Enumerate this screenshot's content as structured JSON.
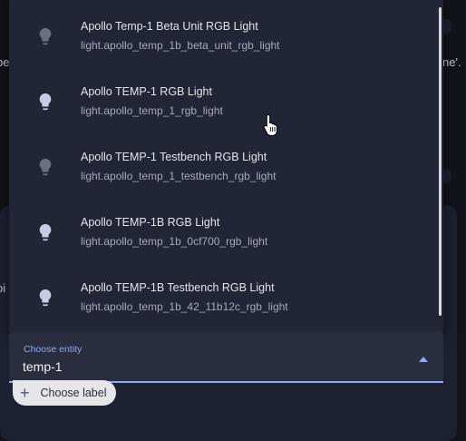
{
  "background": {
    "left_fragment_1": "be",
    "right_fragment_1": "ne'.",
    "left_fragment_2": "oi"
  },
  "dropdown": {
    "items": [
      {
        "name": "Apollo Temp-1 Beta Unit RGB Light",
        "entity": "light.apollo_temp_1b_beta_unit_rgb_light",
        "icon": "lightbulb-icon",
        "icon_color": "#6c6f82"
      },
      {
        "name": "Apollo TEMP-1 RGB Light",
        "entity": "light.apollo_temp_1_rgb_light",
        "icon": "lightbulb-icon",
        "icon_color": "#c7cbe4"
      },
      {
        "name": "Apollo TEMP-1 Testbench RGB Light",
        "entity": "light.apollo_temp_1_testbench_rgb_light",
        "icon": "lightbulb-icon",
        "icon_color": "#6c6f82"
      },
      {
        "name": "Apollo TEMP-1B RGB Light",
        "entity": "light.apollo_temp_1b_0cf700_rgb_light",
        "icon": "lightbulb-icon",
        "icon_color": "#c7cbe4"
      },
      {
        "name": "Apollo TEMP-1B Testbench RGB Light",
        "entity": "light.apollo_temp_1b_42_11b12c_rgb_light",
        "icon": "lightbulb-icon",
        "icon_color": "#c7cbe4"
      }
    ]
  },
  "entity_field": {
    "label": "Choose entity",
    "value": "temp-1"
  },
  "label_chip": {
    "text": "Choose label",
    "icon": "plus-icon"
  },
  "colors": {
    "accent": "#8ea9f3",
    "menu_bg": "#222536",
    "page_bg": "#111318"
  }
}
